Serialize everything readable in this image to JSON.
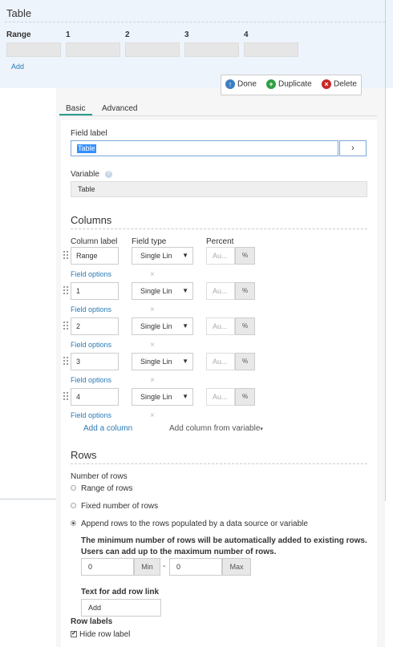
{
  "preview": {
    "title": "Table",
    "headers": [
      "Range",
      "1",
      "2",
      "3",
      "4"
    ],
    "add_label": "Add"
  },
  "actions": {
    "done": "Done",
    "duplicate": "Duplicate",
    "delete": "Delete"
  },
  "tabs": {
    "basic": "Basic",
    "advanced": "Advanced",
    "active": "Basic"
  },
  "field_label": {
    "label": "Field label",
    "value": "Table",
    "button_icon": "chevron-right-icon"
  },
  "variable": {
    "label": "Variable",
    "value": "Table"
  },
  "columns": {
    "title": "Columns",
    "headers": {
      "column_label": "Column label",
      "field_type": "Field type",
      "percent": "Percent"
    },
    "items": [
      {
        "label": "Range",
        "type": "Single Lin",
        "percent_placeholder": "Au...",
        "percent_addon": "%",
        "options": "Field options"
      },
      {
        "label": "1",
        "type": "Single Lin",
        "percent_placeholder": "Au...",
        "percent_addon": "%",
        "options": "Field options"
      },
      {
        "label": "2",
        "type": "Single Lin",
        "percent_placeholder": "Au...",
        "percent_addon": "%",
        "options": "Field options"
      },
      {
        "label": "3",
        "type": "Single Lin",
        "percent_placeholder": "Au...",
        "percent_addon": "%",
        "options": "Field options"
      },
      {
        "label": "4",
        "type": "Single Lin",
        "percent_placeholder": "Au...",
        "percent_addon": "%",
        "options": "Field options"
      }
    ],
    "add_column": "Add a column",
    "add_from_variable": "Add column from variable"
  },
  "rows": {
    "title": "Rows",
    "number_label": "Number of rows",
    "options": [
      "Range of rows",
      "Fixed number of rows",
      "Append rows to the rows populated by a data source or variable"
    ],
    "selected_index": 2,
    "note_line1": "The minimum number of rows will be automatically added to existing rows.",
    "note_line2": "Users can add up to the maximum number of rows.",
    "min_value": "0",
    "min_addon": "Min",
    "separator": "-",
    "max_value": "0",
    "max_addon": "Max",
    "add_link_label": "Text for add row link",
    "add_link_value": "Add",
    "row_labels_label": "Row labels",
    "hide_row_label": "Hide row label",
    "hide_row_checked": true
  },
  "colors": {
    "accent": "#2a7ab5",
    "tab_underline": "#2a9d8f",
    "done": "#3a7fc1",
    "duplicate": "#2ea043",
    "delete": "#c62828"
  }
}
